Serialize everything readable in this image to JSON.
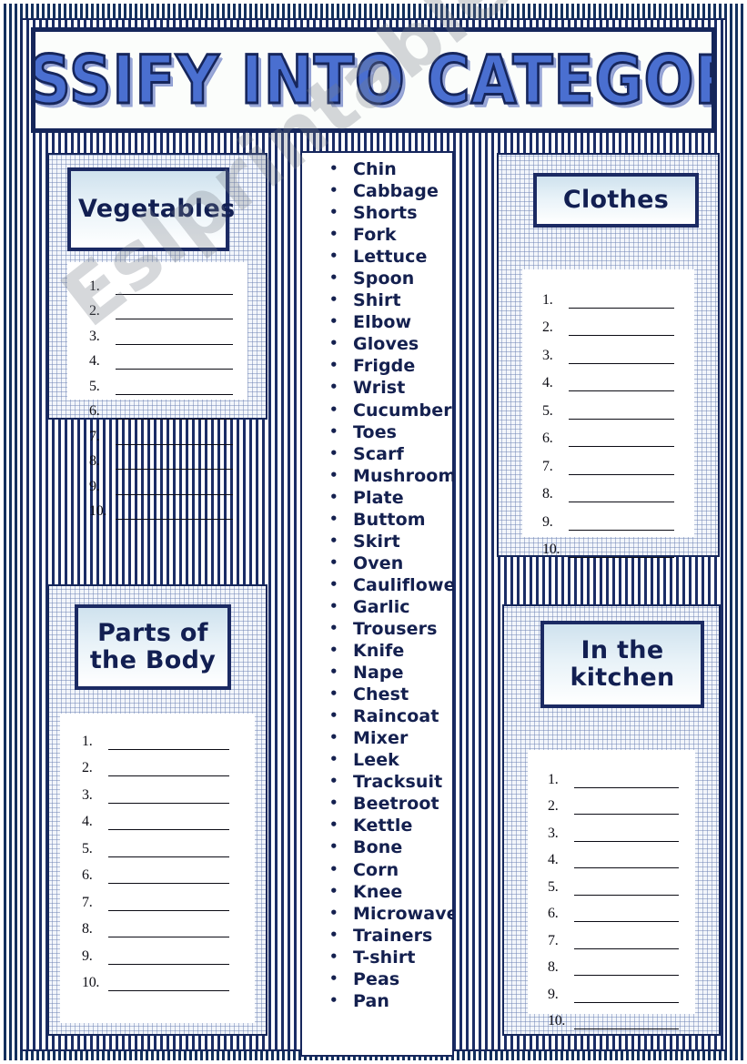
{
  "title": "CLASSIFY INTO CATEGORIES",
  "watermark": "Eslprintables.com",
  "colors": {
    "navy": "#15265a",
    "title_fill": "#4a6fd0",
    "header_gradient_top": "#cfe2ee",
    "card_bg": "#ffffff"
  },
  "word_list": {
    "items": [
      "Chin",
      "Cabbage",
      "Shorts",
      "Fork",
      "Lettuce",
      "Spoon",
      "Shirt",
      "Elbow",
      "Gloves",
      "Frigde",
      "Wrist",
      "Cucumber",
      "Toes",
      "Scarf",
      "Mushroom",
      "Plate",
      "Buttom",
      "Skirt",
      "Oven",
      "Cauliflower",
      "Garlic",
      "Trousers",
      "Knife",
      "Nape",
      "Chest",
      "Raincoat",
      "Mixer",
      "Leek",
      "Tracksuit",
      "Beetroot",
      "Kettle",
      "Bone",
      "Corn",
      "Knee",
      "Microwave",
      "Trainers",
      "T-shirt",
      "Peas",
      "Pan"
    ]
  },
  "categories": [
    {
      "id": "vegetables",
      "title": "Vegetables"
    },
    {
      "id": "clothes",
      "title": "Clothes"
    },
    {
      "id": "parts-of-body",
      "title": "Parts of the Body"
    },
    {
      "id": "in-the-kitchen",
      "title": "In the kitchen"
    }
  ],
  "answer_numbers": [
    "1.",
    "2.",
    "3.",
    "4.",
    "5.",
    "6.",
    "7.",
    "8.",
    "9.",
    "10."
  ]
}
